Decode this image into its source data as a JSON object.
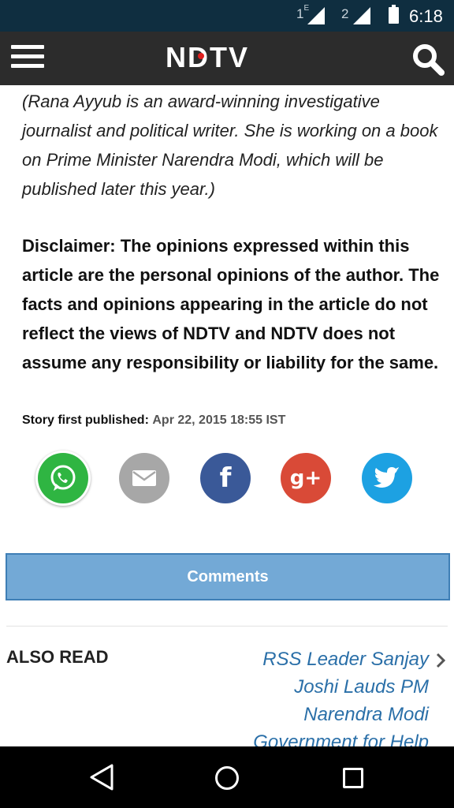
{
  "status_bar": {
    "sim1": "1",
    "sim1_sup": "E",
    "sim2": "2",
    "time": "6:18",
    "icons": [
      "signal-icon",
      "signal-icon",
      "battery-icon"
    ]
  },
  "app_bar": {
    "logo": "NDTV",
    "icons": [
      "menu-icon",
      "search-icon"
    ],
    "accent": "#e0201f"
  },
  "article": {
    "byline": "(Rana Ayyub is an award-winning investigative journalist and political writer. She is working on a book on Prime Minister Narendra Modi, which will be published later this year.)",
    "disclaimer": "Disclaimer: The opinions expressed within this article are the personal opinions of the author. The facts and opinions appearing in the article do not reflect the views of NDTV and NDTV does not assume any responsibility or liability for the same.",
    "published_label": "Story first published:",
    "published_date": "Apr 22, 2015 18:55 IST"
  },
  "share": {
    "icons": [
      "whatsapp-icon",
      "email-icon",
      "facebook-icon",
      "google-plus-icon",
      "twitter-icon"
    ],
    "facebook_glyph": "f",
    "gplus_glyph": "g+"
  },
  "comments": {
    "label": "Comments"
  },
  "also_read": {
    "heading": "ALSO READ",
    "link": "RSS Leader Sanjay Joshi Lauds PM Narendra Modi Government for Help"
  },
  "nav_bar": {
    "icons": [
      "back-icon",
      "home-icon",
      "recent-apps-icon"
    ]
  }
}
